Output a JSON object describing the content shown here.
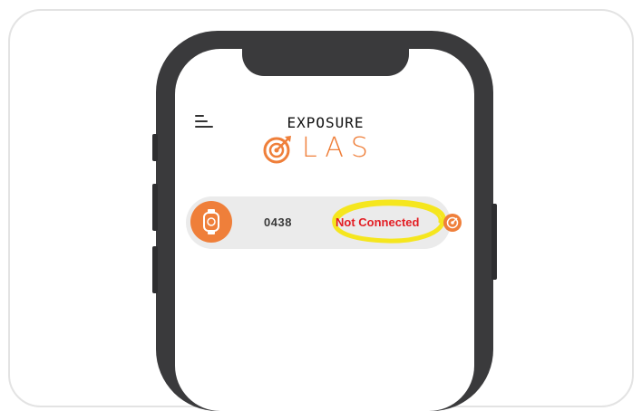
{
  "app": {
    "logo_line1": "EXPOSURE",
    "logo_line2": "LAS"
  },
  "header": {
    "menu_icon": "hamburger-menu-icon"
  },
  "device": {
    "id": "0438",
    "status": "Not Connected",
    "icon": "wearable-device-icon",
    "status_icon": "sync-target-icon"
  },
  "colors": {
    "brand_orange": "#ef7f3a",
    "status_red": "#e31e24",
    "highlight_yellow": "#f5e61e",
    "phone_body": "#3a3a3c",
    "row_background": "#ebebeb"
  }
}
